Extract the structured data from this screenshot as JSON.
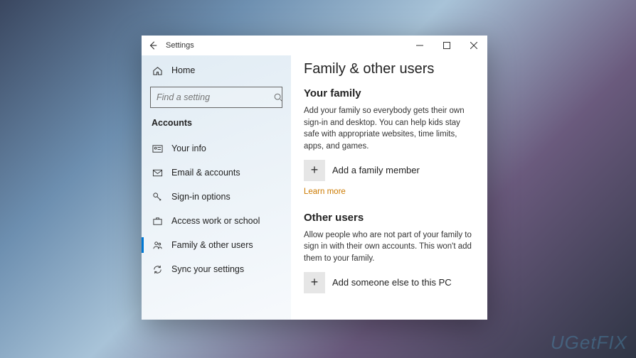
{
  "window": {
    "title": "Settings"
  },
  "sidebar": {
    "home": "Home",
    "search_placeholder": "Find a setting",
    "section": "Accounts",
    "items": [
      {
        "label": "Your info"
      },
      {
        "label": "Email & accounts"
      },
      {
        "label": "Sign-in options"
      },
      {
        "label": "Access work or school"
      },
      {
        "label": "Family & other users"
      },
      {
        "label": "Sync your settings"
      }
    ]
  },
  "content": {
    "heading": "Family & other users",
    "family": {
      "title": "Your family",
      "desc": "Add your family so everybody gets their own sign-in and desktop. You can help kids stay safe with appropriate websites, time limits, apps, and games.",
      "add_label": "Add a family member",
      "learn_more": "Learn more"
    },
    "other": {
      "title": "Other users",
      "desc": "Allow people who are not part of your family to sign in with their own accounts. This won't add them to your family.",
      "add_label": "Add someone else to this PC"
    }
  },
  "watermark": "UGetFIX"
}
